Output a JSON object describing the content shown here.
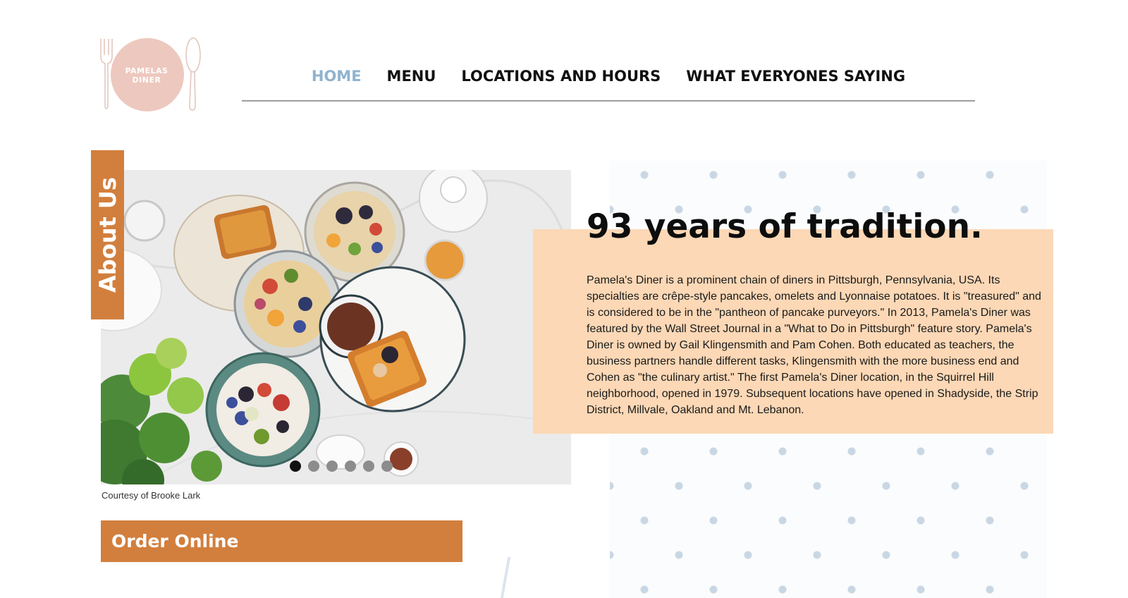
{
  "brand": {
    "name": "PAMELAS DINER",
    "circle_color": "#edc8be",
    "utensil_color": "#e2c3bb"
  },
  "nav": {
    "items": [
      {
        "label": "HOME",
        "active": true
      },
      {
        "label": "MENU",
        "active": false
      },
      {
        "label": "LOCATIONS AND HOURS",
        "active": false
      },
      {
        "label": "WHAT EVERYONES SAYING",
        "active": false
      }
    ],
    "active_color": "#8fb3cf"
  },
  "about_tab": {
    "label": "About Us"
  },
  "hero": {
    "caption": "Courtesy of Brooke Lark",
    "slide_count": 6,
    "active_slide": 1
  },
  "about": {
    "headline": "93 years of tradition.",
    "body": "Pamela's Diner is a prominent chain of diners in Pittsburgh, Pennsylvania, USA. Its specialties are crêpe-style pancakes, omelets and Lyonnaise potatoes. It is \"treasured\" and is considered to be in the \"pantheon of pancake purveyors.\" In 2013, Pamela's Diner was featured by the Wall Street Journal in a \"What to Do in Pittsburgh\" feature story. Pamela's Diner is owned by Gail Klingensmith and Pam Cohen. Both educated as teachers, the business partners handle different tasks, Klingensmith with the more business end and Cohen as \"the culinary artist.\" The first Pamela's Diner location, in the Squirrel Hill neighborhood, opened in 1979. Subsequent locations have opened in Shadyside, the Strip District, Millvale, Oakland and Mt. Lebanon."
  },
  "order": {
    "label": "Order Online"
  },
  "colors": {
    "accent_orange": "#d27f3e",
    "peach": "#fcd8b6",
    "dot_blue": "#c9d7e4"
  }
}
